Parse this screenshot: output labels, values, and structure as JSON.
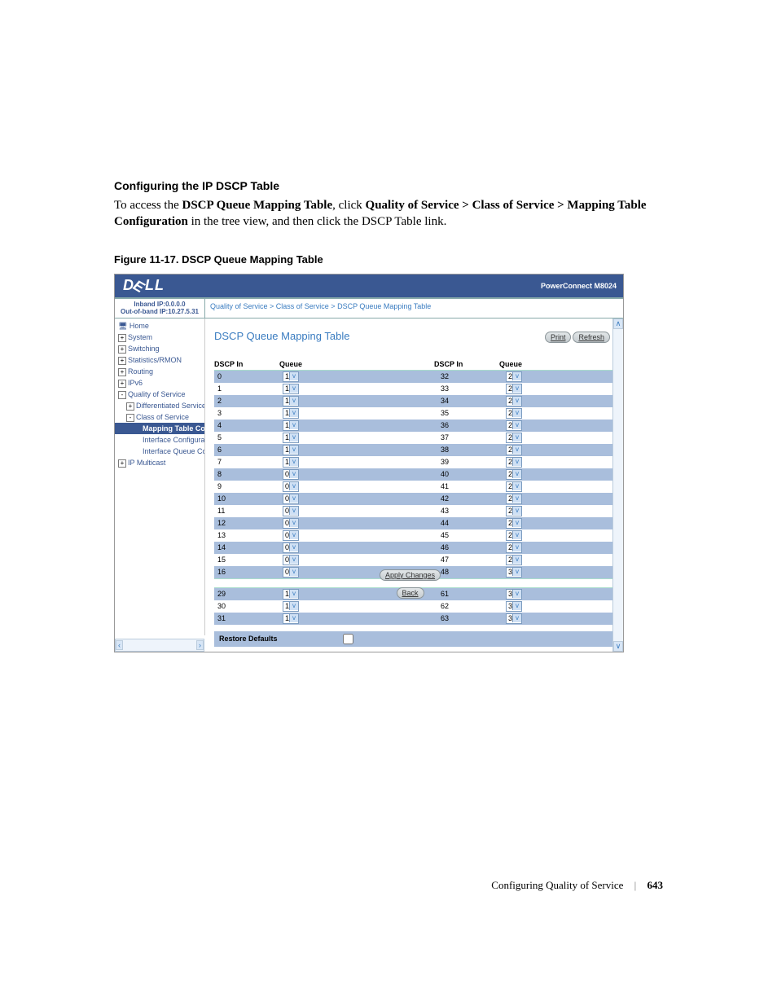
{
  "section_title": "Configuring the IP DSCP Table",
  "body_parts": {
    "p1": "To access the ",
    "b1": "DSCP Queue Mapping Table",
    "p2": ", click ",
    "b2": "Quality of Service > Class of Service > Mapping Table Configuration",
    "p3": " in the tree view, and then click the DSCP Table link."
  },
  "figure_caption": "Figure 11-17.    DSCP Queue Mapping Table",
  "app": {
    "logo": "D LL",
    "product": "PowerConnect M8024",
    "ip1": "Inband IP:0.0.0.0",
    "ip2": "Out-of-band IP:10.27.5.31",
    "crumbs": "Quality of Service > Class of Service > DSCP Queue Mapping Table",
    "nav": [
      {
        "txt": "Home",
        "icon": "home",
        "lvl": 0
      },
      {
        "txt": "System",
        "icon": "+",
        "lvl": 0
      },
      {
        "txt": "Switching",
        "icon": "+",
        "lvl": 0
      },
      {
        "txt": "Statistics/RMON",
        "icon": "+",
        "lvl": 0
      },
      {
        "txt": "Routing",
        "icon": "+",
        "lvl": 0
      },
      {
        "txt": "IPv6",
        "icon": "+",
        "lvl": 0
      },
      {
        "txt": "Quality of Service",
        "icon": "-",
        "lvl": 0
      },
      {
        "txt": "Differentiated Services",
        "icon": "+",
        "lvl": 1
      },
      {
        "txt": "Class of Service",
        "icon": "-",
        "lvl": 1
      },
      {
        "txt": "Mapping Table Configuration",
        "sel": true,
        "lvl": 2
      },
      {
        "txt": "Interface Configuration",
        "lvl": 2
      },
      {
        "txt": "Interface Queue Configuration",
        "lvl": 2
      },
      {
        "txt": "IP Multicast",
        "icon": "+",
        "lvl": 0
      }
    ],
    "panel_title": "DSCP Queue Mapping Table",
    "buttons": {
      "print": "Print",
      "refresh": "Refresh",
      "apply": "Apply Changes",
      "back": "Back"
    },
    "col_headers": {
      "dscp": "DSCP In",
      "queue": "Queue"
    },
    "left_group1": [
      {
        "d": "0",
        "q": "1"
      },
      {
        "d": "1",
        "q": "1"
      },
      {
        "d": "2",
        "q": "1"
      },
      {
        "d": "3",
        "q": "1"
      },
      {
        "d": "4",
        "q": "1"
      },
      {
        "d": "5",
        "q": "1"
      },
      {
        "d": "6",
        "q": "1"
      },
      {
        "d": "7",
        "q": "1"
      },
      {
        "d": "8",
        "q": "0"
      },
      {
        "d": "9",
        "q": "0"
      },
      {
        "d": "10",
        "q": "0"
      },
      {
        "d": "11",
        "q": "0"
      },
      {
        "d": "12",
        "q": "0"
      },
      {
        "d": "13",
        "q": "0"
      },
      {
        "d": "14",
        "q": "0"
      },
      {
        "d": "15",
        "q": "0"
      },
      {
        "d": "16",
        "q": "0"
      }
    ],
    "right_group1": [
      {
        "d": "32",
        "q": "2"
      },
      {
        "d": "33",
        "q": "2"
      },
      {
        "d": "34",
        "q": "2"
      },
      {
        "d": "35",
        "q": "2"
      },
      {
        "d": "36",
        "q": "2"
      },
      {
        "d": "37",
        "q": "2"
      },
      {
        "d": "38",
        "q": "2"
      },
      {
        "d": "39",
        "q": "2"
      },
      {
        "d": "40",
        "q": "2"
      },
      {
        "d": "41",
        "q": "2"
      },
      {
        "d": "42",
        "q": "2"
      },
      {
        "d": "43",
        "q": "2"
      },
      {
        "d": "44",
        "q": "2"
      },
      {
        "d": "45",
        "q": "2"
      },
      {
        "d": "46",
        "q": "2"
      },
      {
        "d": "47",
        "q": "2"
      },
      {
        "d": "48",
        "q": "3"
      }
    ],
    "left_group2": [
      {
        "d": "29",
        "q": "1"
      },
      {
        "d": "30",
        "q": "1"
      },
      {
        "d": "31",
        "q": "1"
      }
    ],
    "right_group2": [
      {
        "d": "61",
        "q": "3"
      },
      {
        "d": "62",
        "q": "3"
      },
      {
        "d": "63",
        "q": "3"
      }
    ],
    "restore_label": "Restore Defaults"
  },
  "footer": {
    "title": "Configuring Quality of Service",
    "page": "643"
  }
}
